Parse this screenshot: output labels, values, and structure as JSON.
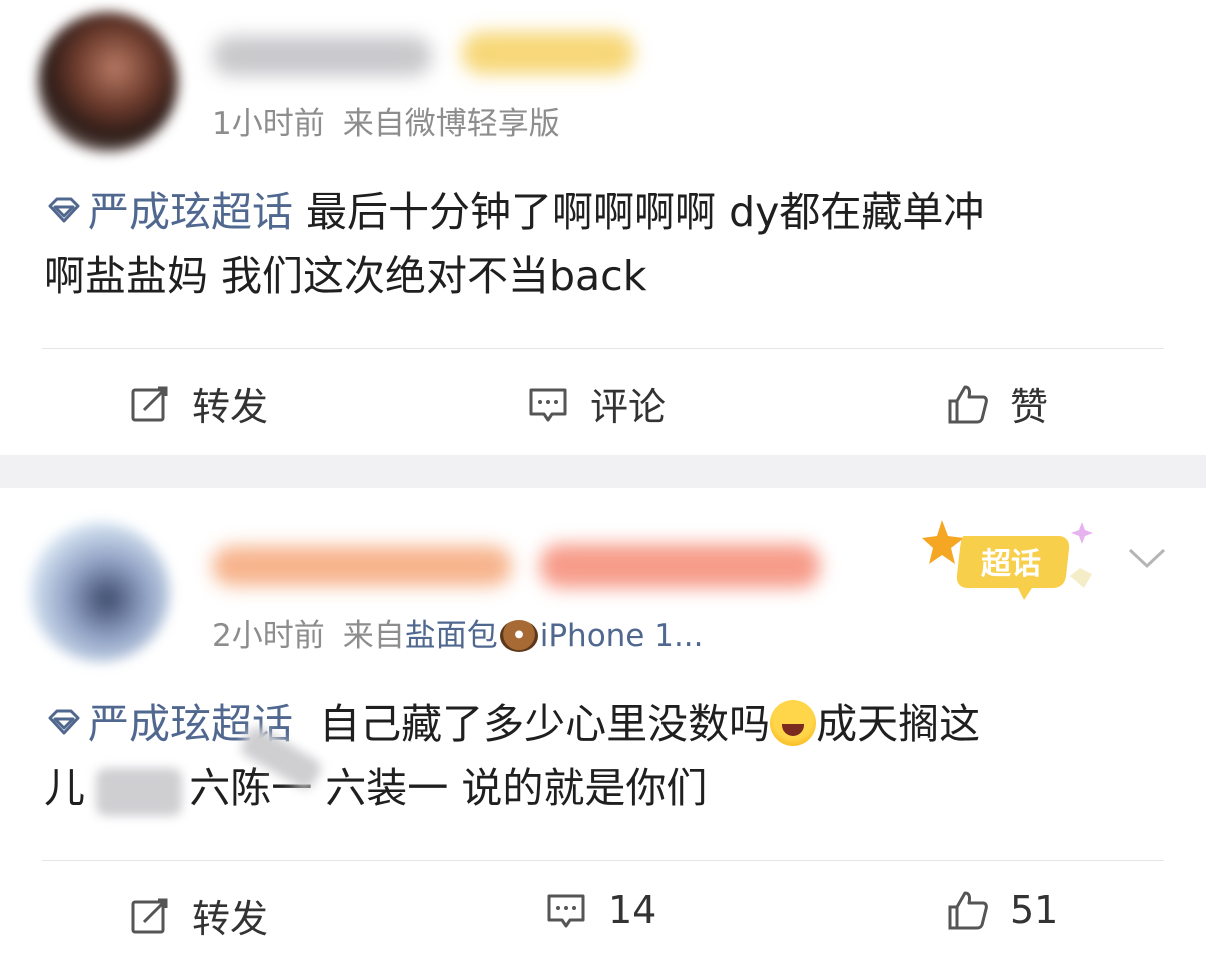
{
  "posts": [
    {
      "time": "1小时前",
      "source": "来自微博轻享版",
      "topic": "严成玹超话",
      "text_line1": "最后十分钟了啊啊啊啊 dy都在藏单冲",
      "text_line2": "啊盐盐妈  我们这次绝对不当back",
      "actions": {
        "repost": "转发",
        "comment": "评论",
        "like": "赞"
      }
    },
    {
      "time": "2小时前",
      "source_prefix": "来自",
      "source_name": "盐面包",
      "source_device": "iPhone 1...",
      "topic": "严成玹超话",
      "text_line1_a": "  自己藏了多少心里没数吗",
      "text_line1_b": "成天搁这",
      "text_line2": "儿        六陈一 六装一 说的就是你们",
      "badge": "超话",
      "actions": {
        "repost": "转发",
        "comment": "14",
        "like": "51"
      }
    }
  ],
  "colors": {
    "topic": "#50688f",
    "meta": "#8d8d8d",
    "separator": "#f1f1f3"
  }
}
